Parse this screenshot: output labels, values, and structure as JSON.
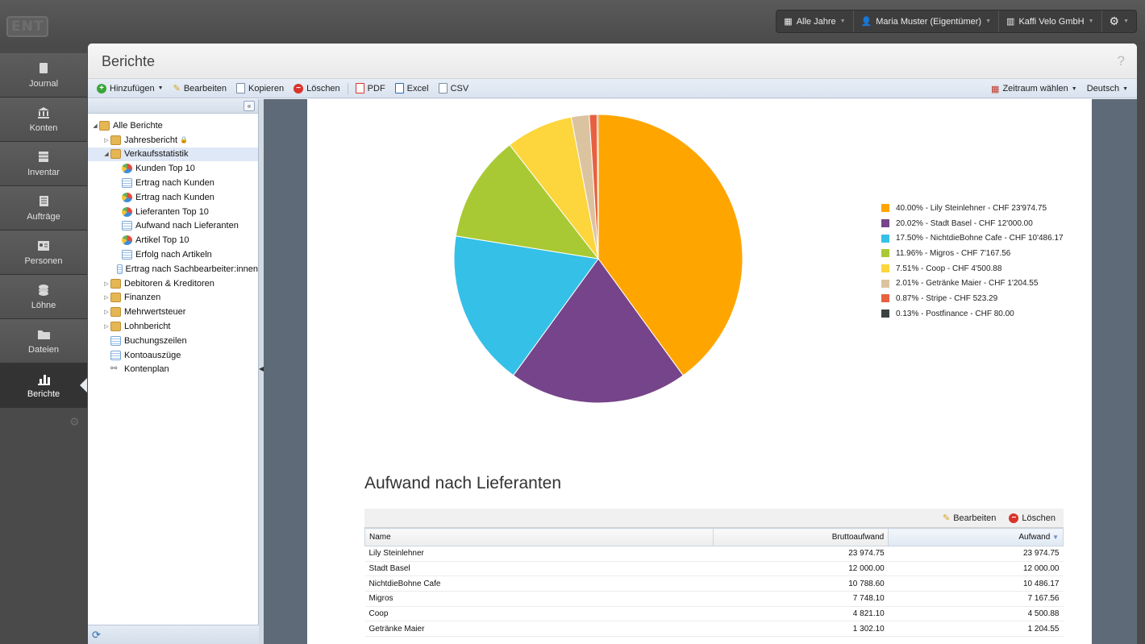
{
  "topbar": {
    "logo": "ENT",
    "menu": [
      {
        "icon": "calendar-icon",
        "label": "Alle Jahre"
      },
      {
        "icon": "user-icon",
        "label": "Maria Muster (Eigentümer)"
      },
      {
        "icon": "building-icon",
        "label": "Kaffi Velo GmbH"
      },
      {
        "icon": "gear-icon",
        "label": ""
      }
    ]
  },
  "nav": [
    {
      "icon": "journal-icon",
      "label": "Journal"
    },
    {
      "icon": "bank-icon",
      "label": "Konten"
    },
    {
      "icon": "inventory-icon",
      "label": "Inventar"
    },
    {
      "icon": "orders-icon",
      "label": "Aufträge"
    },
    {
      "icon": "person-card-icon",
      "label": "Personen"
    },
    {
      "icon": "coins-icon",
      "label": "Löhne"
    },
    {
      "icon": "folder-icon",
      "label": "Dateien"
    },
    {
      "icon": "bar-chart-icon",
      "label": "Berichte"
    }
  ],
  "window": {
    "title": "Berichte",
    "help": "?"
  },
  "toolbar": {
    "add": "Hinzufügen",
    "edit": "Bearbeiten",
    "copy": "Kopieren",
    "delete": "Löschen",
    "pdf": "PDF",
    "excel": "Excel",
    "csv": "CSV",
    "period": "Zeitraum wählen",
    "language": "Deutsch"
  },
  "tree": {
    "collapse": "«",
    "items": [
      {
        "label": "Alle Berichte",
        "level": 0,
        "icon": "folder",
        "toggle": "◢"
      },
      {
        "label": "Jahresbericht",
        "level": 1,
        "icon": "folder",
        "toggle": "▷",
        "locked": true
      },
      {
        "label": "Verkaufsstatistik",
        "level": 1,
        "icon": "folder",
        "toggle": "◢"
      },
      {
        "label": "Kunden Top 10",
        "level": 2,
        "icon": "pie"
      },
      {
        "label": "Ertrag nach Kunden",
        "level": 2,
        "icon": "table"
      },
      {
        "label": "Ertrag nach Kunden",
        "level": 2,
        "icon": "pie"
      },
      {
        "label": "Lieferanten Top 10",
        "level": 2,
        "icon": "pie"
      },
      {
        "label": "Aufwand nach Lieferanten",
        "level": 2,
        "icon": "table"
      },
      {
        "label": "Artikel Top 10",
        "level": 2,
        "icon": "pie"
      },
      {
        "label": "Erfolg nach Artikeln",
        "level": 2,
        "icon": "table"
      },
      {
        "label": "Ertrag nach Sachbearbeiter:innen",
        "level": 2,
        "icon": "table"
      },
      {
        "label": "Debitoren & Kreditoren",
        "level": 1,
        "icon": "folder",
        "toggle": "▷"
      },
      {
        "label": "Finanzen",
        "level": 1,
        "icon": "folder",
        "toggle": "▷"
      },
      {
        "label": "Mehrwertsteuer",
        "level": 1,
        "icon": "folder",
        "toggle": "▷"
      },
      {
        "label": "Lohnbericht",
        "level": 1,
        "icon": "folder",
        "toggle": "▷"
      },
      {
        "label": "Buchungszeilen",
        "level": 1,
        "icon": "table"
      },
      {
        "label": "Kontoauszüge",
        "level": 1,
        "icon": "table"
      },
      {
        "label": "Kontenplan",
        "level": 1,
        "icon": "graph"
      }
    ]
  },
  "chart_data": {
    "type": "pie",
    "slices": [
      {
        "label": "40.00% - Lily Steinlehner - CHF 23'974.75",
        "value": 40.0,
        "color": "#FFA500"
      },
      {
        "label": "20.02% - Stadt Basel - CHF 12'000.00",
        "value": 20.02,
        "color": "#76448A"
      },
      {
        "label": "17.50% - NichtdieBohne Cafe - CHF 10'486.17",
        "value": 17.5,
        "color": "#35C0E8"
      },
      {
        "label": "11.96% - Migros - CHF 7'167.56",
        "value": 11.96,
        "color": "#A9C934"
      },
      {
        "label": "7.51% - Coop - CHF 4'500.88",
        "value": 7.51,
        "color": "#FDD53C"
      },
      {
        "label": "2.01% - Getränke Maier - CHF 1'204.55",
        "value": 2.01,
        "color": "#DCC3A0"
      },
      {
        "label": "0.87% - Stripe - CHF 523.29",
        "value": 0.87,
        "color": "#E76141"
      },
      {
        "label": "0.13% - Postfinance - CHF 80.00",
        "value": 0.13,
        "color": "#3B4243"
      }
    ],
    "legend": "right"
  },
  "report": {
    "title": "Aufwand nach Lieferanten",
    "edit": "Bearbeiten",
    "delete": "Löschen",
    "columns": [
      "Name",
      "Bruttoaufwand",
      "Aufwand"
    ],
    "rows": [
      [
        "Lily Steinlehner",
        "23 974.75",
        "23 974.75"
      ],
      [
        "Stadt Basel",
        "12 000.00",
        "12 000.00"
      ],
      [
        "NichtdieBohne Cafe",
        "10 788.60",
        "10 486.17"
      ],
      [
        "Migros",
        "7 748.10",
        "7 167.56"
      ],
      [
        "Coop",
        "4 821.10",
        "4 500.88"
      ],
      [
        "Getränke Maier",
        "1 302.10",
        "1 204.55"
      ]
    ]
  }
}
